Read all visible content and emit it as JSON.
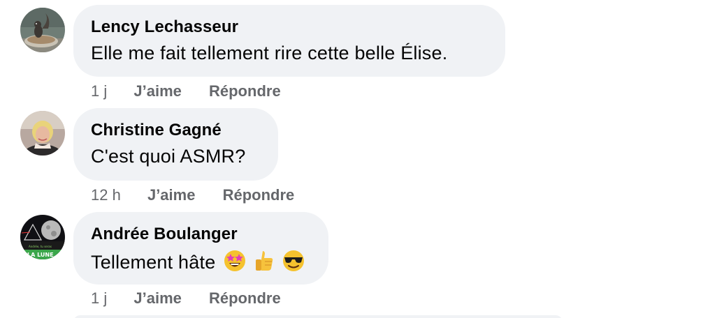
{
  "comments": [
    {
      "author": "Lency Lechasseur",
      "text": "Elle me fait tellement rire cette belle Élise.",
      "time": "1 j",
      "like_label": "J’aime",
      "reply_label": "Répondre"
    },
    {
      "author": "Christine Gagné",
      "text": "C'est quoi ASMR?",
      "time": "12 h",
      "like_label": "J’aime",
      "reply_label": "Répondre"
    },
    {
      "author": "Andrée Boulanger",
      "text": "Tellement hâte",
      "emojis": [
        "star-struck-emoji",
        "thumbs-up-emoji",
        "sunglasses-emoji"
      ],
      "avatar_text": "LA LUNE",
      "time": "1 j",
      "like_label": "J’aime",
      "reply_label": "Répondre"
    }
  ],
  "colors": {
    "bubble": "#f0f2f5",
    "meta": "#65676b",
    "text": "#050505"
  }
}
